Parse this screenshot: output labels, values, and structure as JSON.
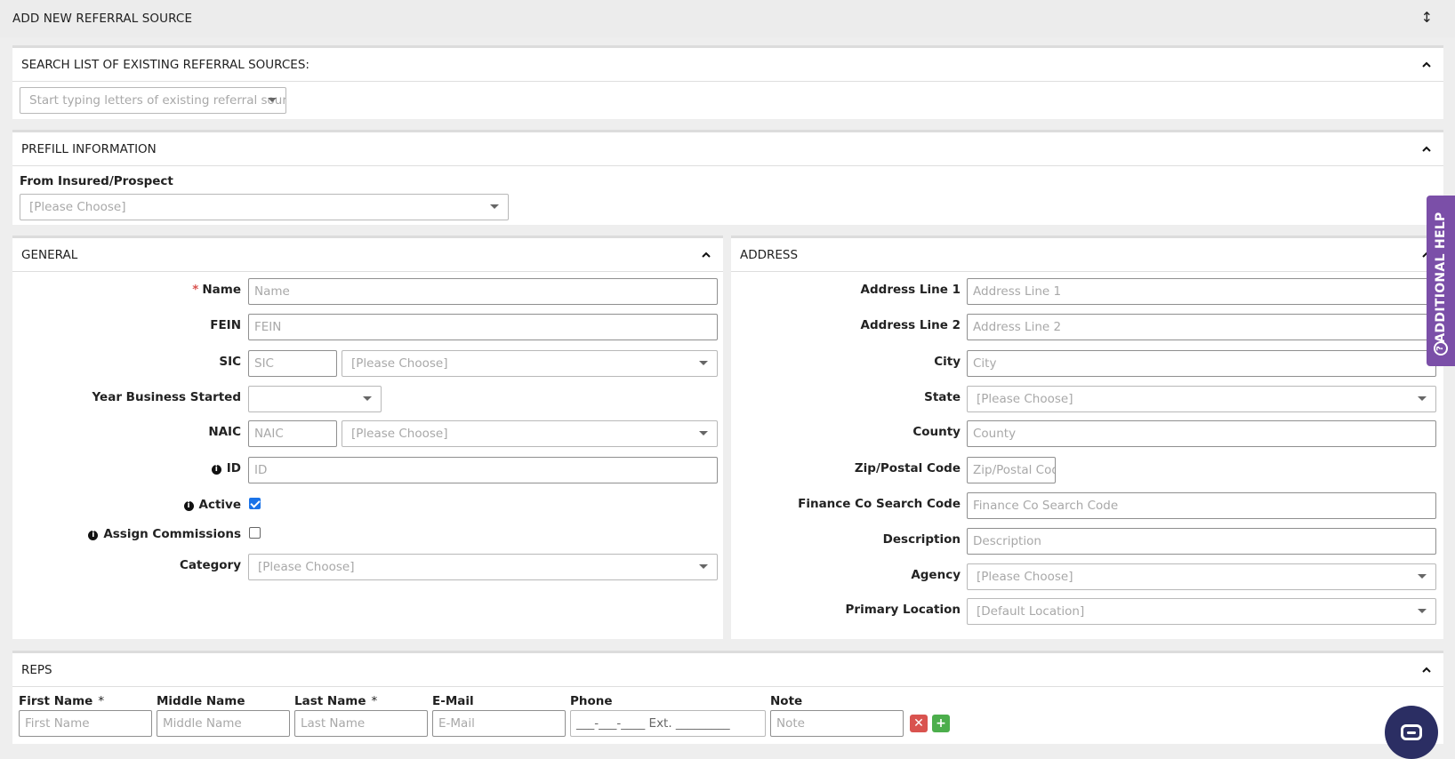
{
  "page": {
    "title": "ADD NEW REFERRAL SOURCE",
    "resize_icon": "vertical-resize-icon"
  },
  "search_panel": {
    "title": "SEARCH LIST OF EXISTING REFERRAL SOURCES:",
    "placeholder": "Start typing letters of existing referral sourc"
  },
  "prefill_panel": {
    "title": "PREFILL INFORMATION",
    "from_label": "From Insured/Prospect",
    "from_placeholder": "[Please Choose]"
  },
  "general": {
    "title": "GENERAL",
    "name_label": "Name",
    "name_placeholder": "Name",
    "fein_label": "FEIN",
    "fein_placeholder": "FEIN",
    "sic_label": "SIC",
    "sic_placeholder": "SIC",
    "sic_select": "[Please Choose]",
    "year_label": "Year Business Started",
    "year_value": "",
    "naic_label": "NAIC",
    "naic_placeholder": "NAIC",
    "naic_select": "[Please Choose]",
    "id_label": "ID",
    "id_placeholder": "ID",
    "active_label": "Active",
    "active_checked": true,
    "assign_label": "Assign Commissions",
    "assign_checked": false,
    "category_label": "Category",
    "category_select": "[Please Choose]"
  },
  "address": {
    "title": "ADDRESS",
    "line1_label": "Address Line 1",
    "line1_placeholder": "Address Line 1",
    "line2_label": "Address Line 2",
    "line2_placeholder": "Address Line 2",
    "city_label": "City",
    "city_placeholder": "City",
    "state_label": "State",
    "state_select": "[Please Choose]",
    "county_label": "County",
    "county_placeholder": "County",
    "zip_label": "Zip/Postal Code",
    "zip_placeholder": "Zip/Postal Cod",
    "finance_label": "Finance Co Search Code",
    "finance_placeholder": "Finance Co Search Code",
    "description_label": "Description",
    "description_placeholder": "Description",
    "agency_label": "Agency",
    "agency_select": "[Please Choose]",
    "primary_label": "Primary Location",
    "primary_select": "[Default Location]"
  },
  "reps": {
    "title": "REPS",
    "columns": {
      "first_name": "First Name",
      "middle_name": "Middle Name",
      "last_name": "Last Name",
      "email": "E-Mail",
      "phone": "Phone",
      "note": "Note"
    },
    "required_star": "*",
    "placeholders": {
      "first_name": "First Name",
      "middle_name": "Middle Name",
      "last_name": "Last Name",
      "email": "E-Mail",
      "phone": "___-___-____ Ext. _________",
      "note": "Note"
    },
    "remove_label": "✕",
    "add_label": "+"
  },
  "help_tab": {
    "label": "ADDITIONAL HELP",
    "icon": "?"
  },
  "icons": {
    "chevron": "chevron-up-icon",
    "chat": "chat-icon",
    "info": "info-icon"
  }
}
